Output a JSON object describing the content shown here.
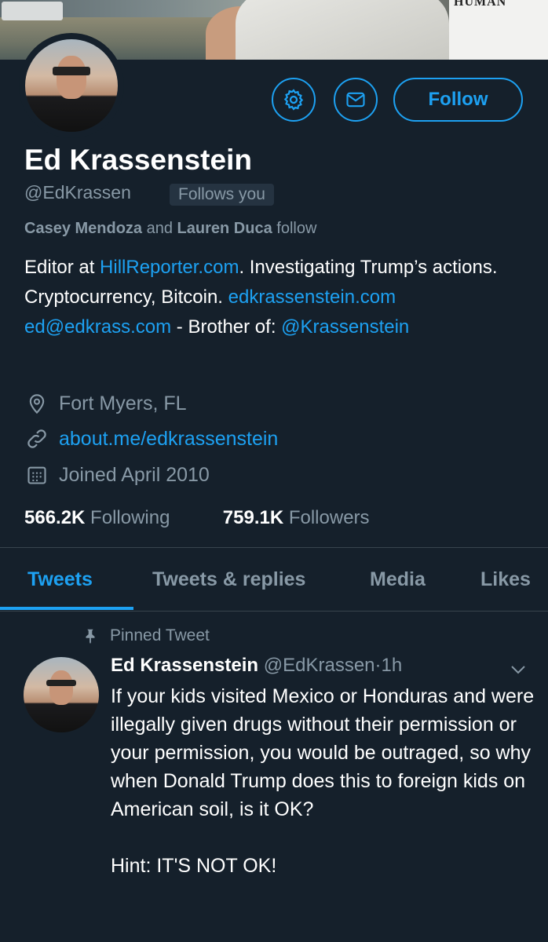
{
  "banner": {
    "poster_text": "HUMAN"
  },
  "actions": {
    "follow_label": "Follow"
  },
  "profile": {
    "name": "Ed Krassenstein",
    "handle": "@EdKrassen",
    "follows_you": "Follows you",
    "followed_by": {
      "user1": "Casey Mendoza",
      "joiner": " and ",
      "user2": "Lauren Duca",
      "suffix": " follow"
    },
    "bio": {
      "p1": "Editor at ",
      "link1": "HillReporter.com",
      "p2": ". Investigating Trump’s actions. Cryptocurrency, Bitcoin. ",
      "link2": "edkrassenstein.com",
      "space": " ",
      "link3": "ed@edkrass.com",
      "p3": " - Brother of: ",
      "link4": "@Krassenstein"
    },
    "location": "Fort Myers, FL",
    "website": "about.me/edkrassenstein",
    "joined": "Joined April 2010",
    "following_count": "566.2K",
    "following_label": " Following",
    "followers_count": "759.1K",
    "followers_label": " Followers"
  },
  "tabs": [
    {
      "label": "Tweets"
    },
    {
      "label": "Tweets & replies"
    },
    {
      "label": "Media"
    },
    {
      "label": "Likes"
    }
  ],
  "pinned_tweet": {
    "pinned_label": "Pinned Tweet",
    "author_name": "Ed Krassenstein",
    "author_handle": "@EdKrassen",
    "separator": "·",
    "time": "1h",
    "text": "If your kids visited Mexico or Honduras and were illegally given drugs without their permission or your permission, you would be outraged, so why when Donald Trump does this to foreign kids on American soil, is it OK?\n\nHint: IT'S NOT OK!"
  },
  "colors": {
    "background": "#15202b",
    "accent": "#1da1f2",
    "muted": "#8899a6"
  },
  "icons": [
    "gear-icon",
    "mail-icon",
    "location-pin-icon",
    "link-icon",
    "calendar-icon",
    "pin-icon",
    "chevron-down-icon"
  ]
}
